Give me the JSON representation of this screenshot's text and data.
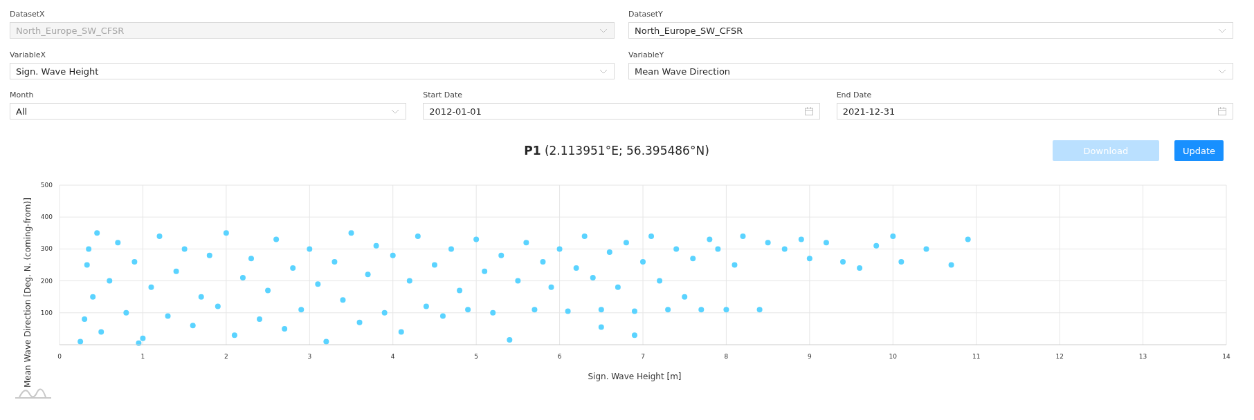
{
  "filters": [
    {
      "label": "DatasetX",
      "value": "North_Europe_SW_CFSR",
      "kind": "select",
      "disabled": true
    },
    {
      "label": "DatasetY",
      "value": "North_Europe_SW_CFSR",
      "kind": "select",
      "disabled": false
    },
    {
      "label": "VariableX",
      "value": "Sign. Wave Height",
      "kind": "select",
      "disabled": false
    },
    {
      "label": "VariableY",
      "value": "Mean Wave Direction",
      "kind": "select",
      "disabled": false
    }
  ],
  "date_filters": [
    {
      "label": "Month",
      "value": "All",
      "kind": "select"
    },
    {
      "label": "Start Date",
      "value": "2012-01-01",
      "kind": "date"
    },
    {
      "label": "End Date",
      "value": "2021-12-31",
      "kind": "date"
    }
  ],
  "plot": {
    "title": "**P1** (2.113951°E; 56.395486°N)",
    "buttons": [
      {
        "label": "Download",
        "disabled": true
      },
      {
        "label": "Update",
        "disabled": false
      }
    ],
    "chart_data": {
      "type": "scatter",
      "xlabel": "Sign. Wave Height [m]",
      "ylabel": "Mean Wave Direction [Deg. N. (coming-from)]",
      "xlim": [
        0,
        14
      ],
      "ylim": [
        0,
        500
      ],
      "grid": true,
      "xticks": [
        0,
        1,
        2,
        3,
        4,
        5,
        6,
        7,
        8,
        9,
        10,
        11,
        12,
        13,
        14
      ],
      "yticks": [
        100,
        200,
        300,
        400,
        500
      ],
      "x": [
        0.25,
        0.3,
        0.33,
        0.35,
        0.4,
        0.45,
        0.5,
        0.6,
        0.7,
        0.8,
        0.9,
        1.0,
        1.1,
        1.2,
        1.3,
        1.4,
        1.5,
        1.6,
        1.7,
        1.8,
        1.9,
        2.0,
        2.1,
        2.2,
        2.3,
        2.4,
        2.5,
        2.6,
        2.7,
        2.8,
        2.9,
        3.0,
        3.1,
        3.2,
        3.3,
        3.4,
        3.5,
        3.6,
        3.7,
        3.8,
        3.9,
        4.0,
        4.1,
        4.2,
        4.3,
        4.4,
        4.5,
        4.6,
        4.7,
        4.8,
        4.9,
        5.0,
        5.1,
        5.2,
        5.3,
        5.4,
        5.5,
        5.6,
        5.7,
        5.8,
        5.9,
        6.0,
        6.1,
        6.2,
        6.3,
        6.4,
        6.5,
        6.6,
        6.7,
        6.8,
        6.9,
        7.0,
        7.1,
        7.2,
        7.3,
        7.4,
        7.5,
        7.6,
        7.7,
        7.8,
        7.9,
        8.0,
        8.1,
        8.2,
        8.4,
        8.5,
        8.7,
        8.9,
        9.0,
        9.2,
        9.4,
        9.6,
        9.8,
        10.0,
        10.1,
        10.4,
        10.7,
        10.9,
        0.95,
        6.9,
        6.5
      ],
      "series": [
        {
          "color": "#5ad3ff",
          "values": [
            10,
            80,
            250,
            300,
            150,
            350,
            40,
            200,
            320,
            100,
            260,
            20,
            180,
            340,
            90,
            230,
            300,
            60,
            150,
            280,
            120,
            350,
            30,
            210,
            270,
            80,
            170,
            330,
            50,
            240,
            110,
            300,
            190,
            10,
            260,
            140,
            350,
            70,
            220,
            310,
            100,
            280,
            40,
            200,
            340,
            120,
            250,
            90,
            300,
            170,
            110,
            330,
            230,
            100,
            280,
            15,
            200,
            320,
            110,
            260,
            180,
            300,
            105,
            240,
            340,
            210,
            110,
            290,
            180,
            320,
            105,
            260,
            340,
            200,
            110,
            300,
            150,
            270,
            110,
            330,
            300,
            110,
            250,
            340,
            110,
            320,
            300,
            330,
            270,
            320,
            260,
            240,
            310,
            340,
            260,
            300,
            250,
            330,
            5,
            30,
            55
          ]
        }
      ]
    }
  }
}
